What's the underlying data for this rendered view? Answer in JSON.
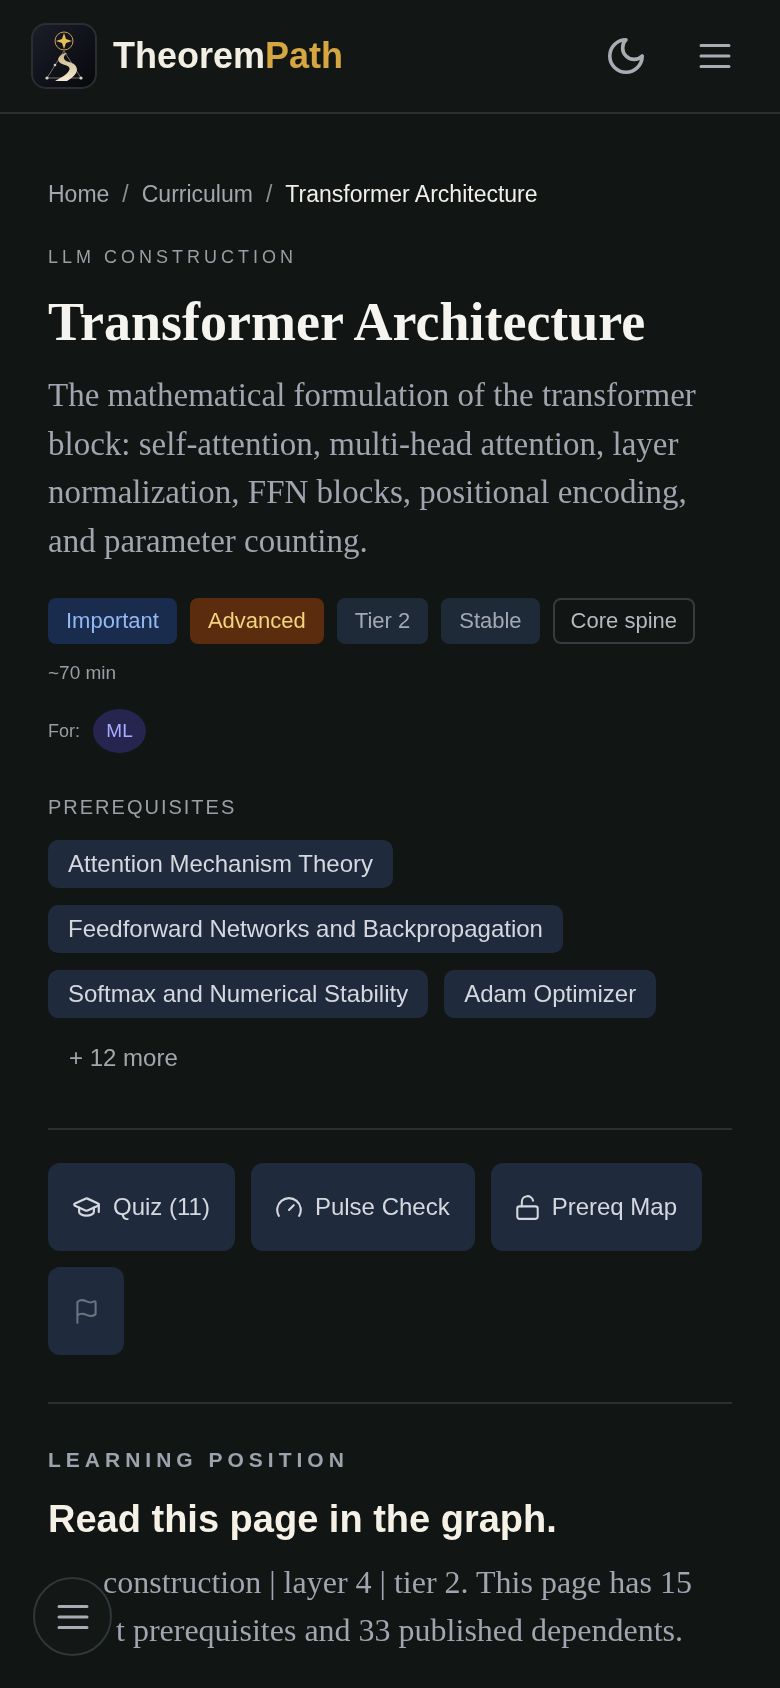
{
  "header": {
    "brand": {
      "name": "Theorem",
      "accent": "Path"
    }
  },
  "breadcrumb": [
    {
      "label": "Home",
      "current": false,
      "separator": "/"
    },
    {
      "label": "Curriculum",
      "current": false,
      "separator": "/"
    },
    {
      "label": "Transformer Architecture",
      "current": true
    }
  ],
  "topic": {
    "category": "LLM CONSTRUCTION",
    "title": "Transformer Architecture",
    "summary": "The mathematical formulation of the transformer block: self-attention, multi-head attention, layer normalization, FFN blocks, positional encoding, and parameter counting."
  },
  "tags": [
    {
      "label": "Important",
      "kind": "importance"
    },
    {
      "label": "Advanced",
      "kind": "difficulty"
    },
    {
      "label": "Tier 2",
      "kind": "tier"
    },
    {
      "label": "Stable",
      "kind": "status"
    },
    {
      "label": "Core spine",
      "kind": "track"
    }
  ],
  "duration": "~70 min",
  "audience": {
    "label": "For:",
    "badges": [
      "ML"
    ]
  },
  "prerequisites": {
    "heading": "PREREQUISITES",
    "items": [
      "Attention Mechanism Theory",
      "Feedforward Networks and Backpropagation",
      "Softmax and Numerical Stability",
      "Adam Optimizer"
    ],
    "more": "+ 12 more"
  },
  "actions": [
    {
      "label": "Quiz (11)"
    },
    {
      "label": "Pulse Check"
    },
    {
      "label": "Prereq Map"
    }
  ],
  "learning_position": {
    "eyebrow": "LEARNING POSITION",
    "heading": "Read this page in the graph.",
    "lines": [
      "construction | layer 4 | tier 2. This page has 15",
      "t prerequisites and 33 published dependents."
    ]
  }
}
